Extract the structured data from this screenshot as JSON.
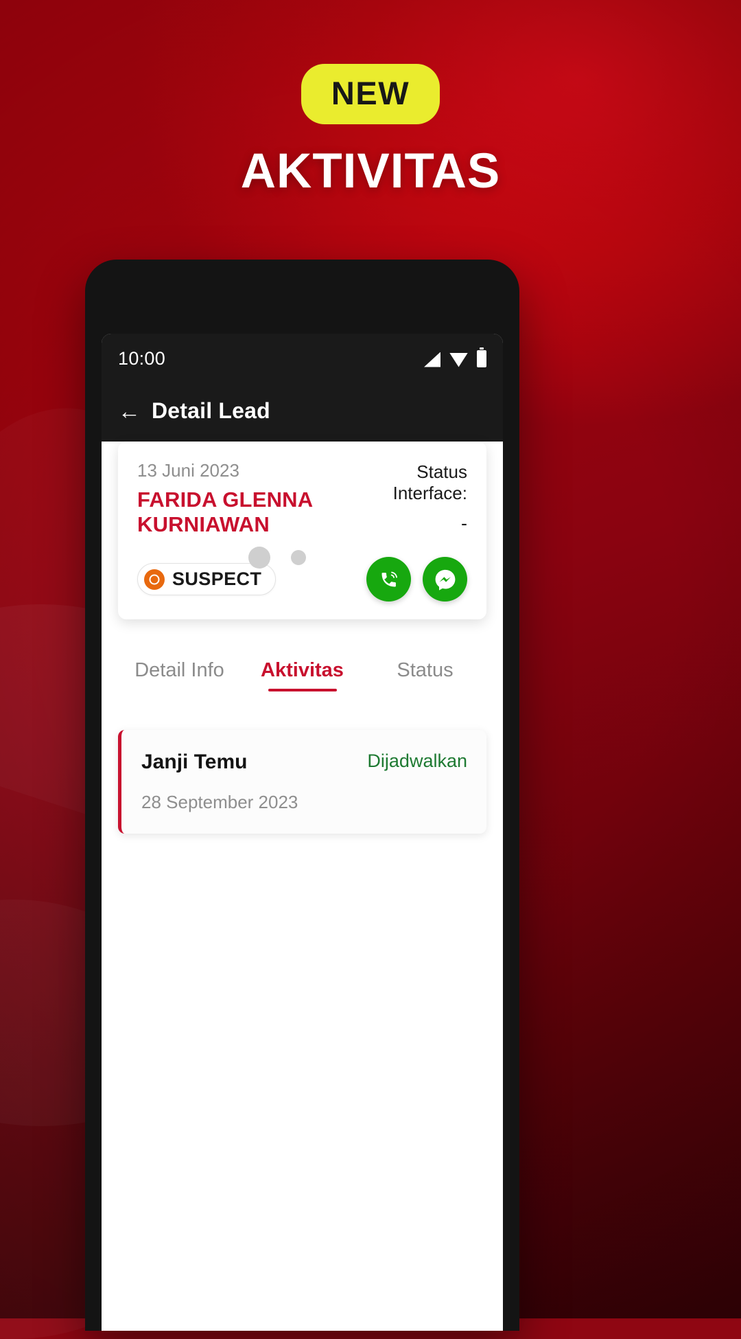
{
  "hero": {
    "badge": "NEW",
    "title": "AKTIVITAS",
    "badge_color": "#eaec2e",
    "title_color": "#ffffff",
    "background_color": "#a0030d"
  },
  "phone": {
    "statusbar": {
      "time": "10:00",
      "icons": [
        "signal-icon",
        "wifi-icon",
        "battery-icon"
      ]
    },
    "header": {
      "back_icon": "arrow-left-icon",
      "title": "Detail Lead"
    },
    "lead_card": {
      "date": "13 Juni 2023",
      "name": "FARIDA GLENNA KURNIAWAN",
      "name_color": "#c8102e",
      "status_label": "Status Interface:",
      "status_value": "-",
      "chip": {
        "icon": "target-icon",
        "icon_color": "#e8690f",
        "label": "SUSPECT"
      },
      "actions": [
        {
          "icon": "whatsapp-call-icon",
          "color": "#17a80f"
        },
        {
          "icon": "messenger-icon",
          "color": "#17a80f"
        }
      ]
    },
    "tabs": [
      {
        "label": "Detail Info",
        "active": false
      },
      {
        "label": "Aktivitas",
        "active": true
      },
      {
        "label": "Status",
        "active": false
      }
    ],
    "activities": [
      {
        "title": "Janji Temu",
        "status": "Dijadwalkan",
        "status_color": "#1e7a32",
        "date": "28 September 2023"
      }
    ]
  }
}
